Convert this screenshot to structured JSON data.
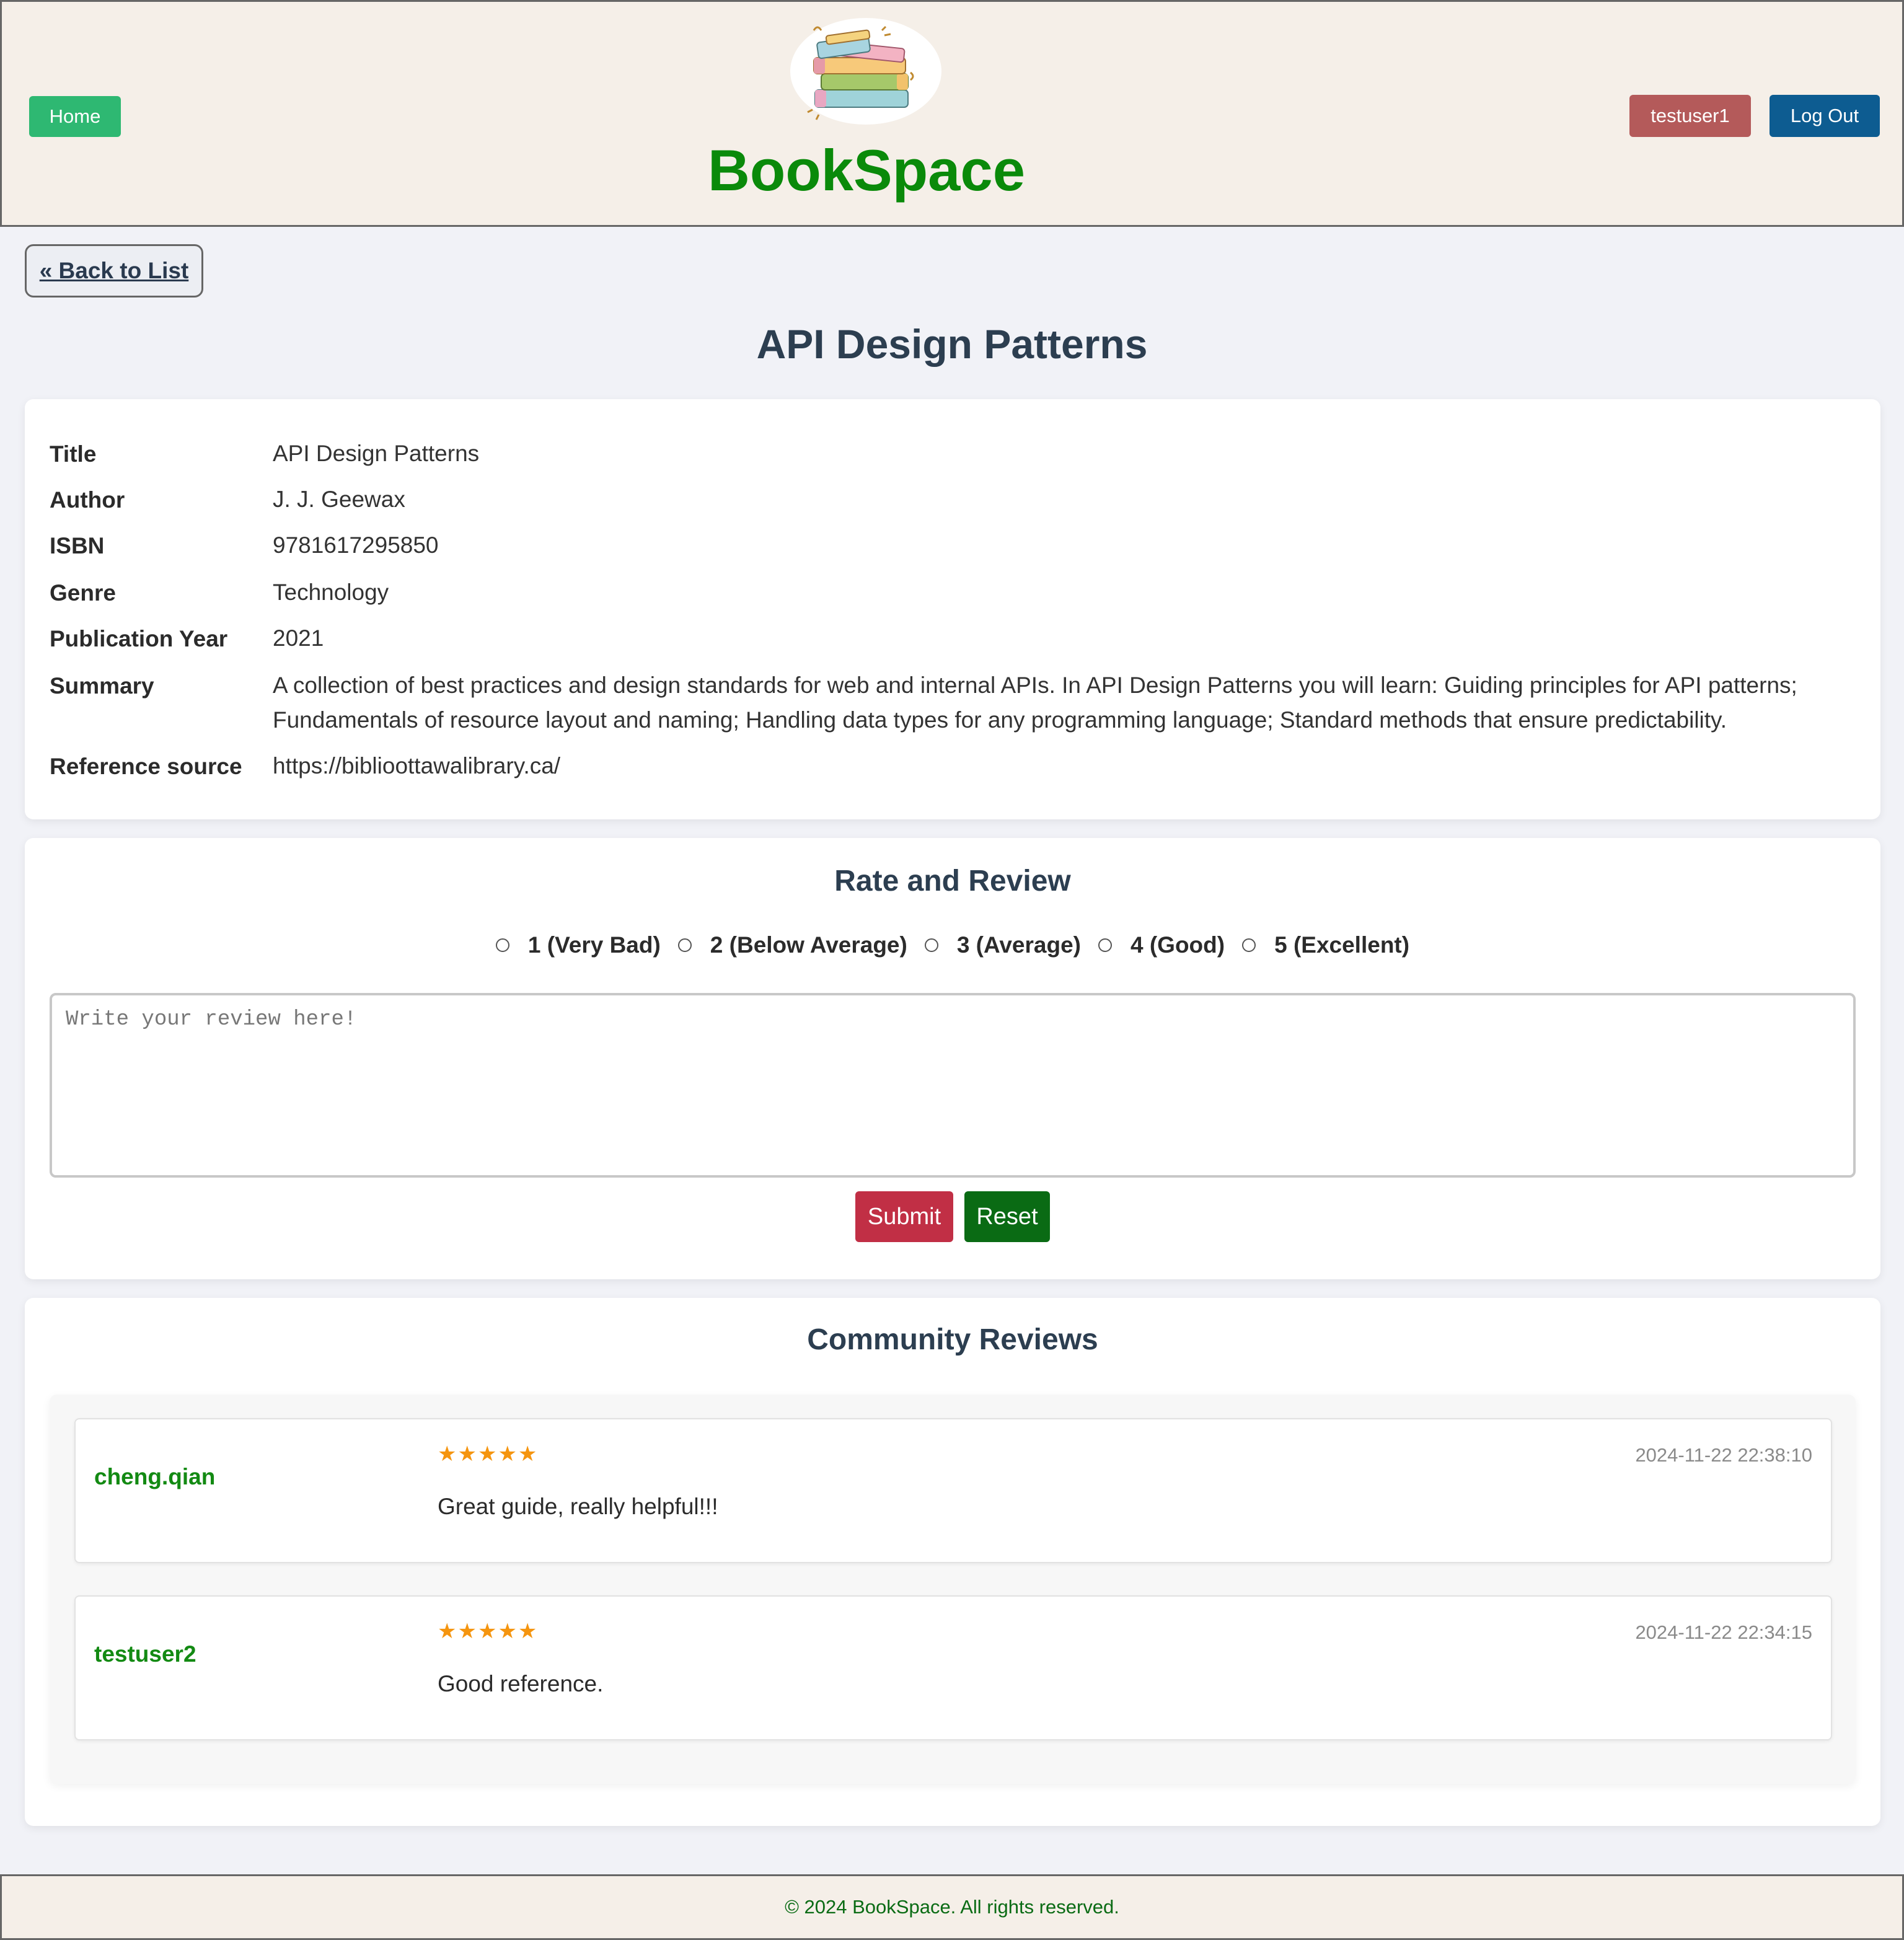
{
  "header": {
    "home_label": "Home",
    "brand": "BookSpace",
    "user_label": "testuser1",
    "logout_label": "Log Out",
    "logo_icon": "stack-of-books-icon"
  },
  "nav": {
    "back_label": "« Back to List"
  },
  "page": {
    "title": "API Design Patterns"
  },
  "details": {
    "rows": [
      {
        "label": "Title",
        "value": "API Design Patterns"
      },
      {
        "label": "Author",
        "value": "J. J. Geewax"
      },
      {
        "label": "ISBN",
        "value": "9781617295850"
      },
      {
        "label": "Genre",
        "value": "Technology"
      },
      {
        "label": "Publication Year",
        "value": "2021"
      },
      {
        "label": "Summary",
        "value": "A collection of best practices and design standards for web and internal APIs. In API Design Patterns you will learn: Guiding principles for API patterns; Fundamentals of resource layout and naming; Handling data types for any programming language; Standard methods that ensure predictability."
      },
      {
        "label": "Reference source",
        "value": "https://biblioottawalibrary.ca/"
      }
    ]
  },
  "review_form": {
    "heading": "Rate and Review",
    "options": [
      {
        "label": "1 (Very Bad)"
      },
      {
        "label": "2 (Below Average)"
      },
      {
        "label": "3 (Average)"
      },
      {
        "label": "4 (Good)"
      },
      {
        "label": "5 (Excellent)"
      }
    ],
    "selected": null,
    "textarea_placeholder": "Write your review here!",
    "textarea_value": "",
    "submit_label": "Submit",
    "reset_label": "Reset"
  },
  "community": {
    "heading": "Community Reviews",
    "reviews": [
      {
        "user": "cheng.qian",
        "stars": "★★★★★",
        "rating": 5,
        "date": "2024-11-22 22:38:10",
        "text": "Great guide, really helpful!!!"
      },
      {
        "user": "testuser2",
        "stars": "★★★★★",
        "rating": 5,
        "date": "2024-11-22 22:34:15",
        "text": "Good reference."
      }
    ]
  },
  "footer": {
    "text": "© 2024 BookSpace. All rights reserved."
  },
  "colors": {
    "header_bg": "#f5efe8",
    "page_bg": "#f1f2f7",
    "brand": "#0a8a0a",
    "home_btn": "#2eb872",
    "user_btn": "#b45a5a",
    "logout_btn": "#0d5c91",
    "submit_btn": "#c12f45",
    "reset_btn": "#0a6b14",
    "star": "#f5950f",
    "username": "#138a13"
  }
}
